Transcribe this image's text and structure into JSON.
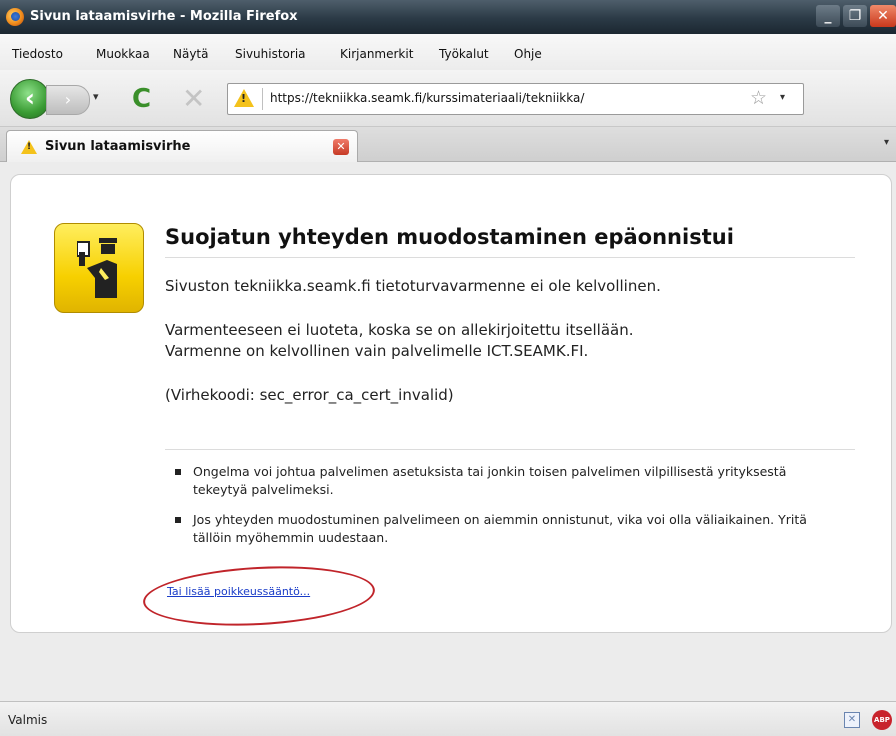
{
  "window": {
    "title": "Sivun lataamisvirhe - Mozilla Firefox",
    "controls": {
      "minimize": "_",
      "maximize": "❐",
      "close": "✕"
    }
  },
  "menu": [
    {
      "label": "Tiedosto"
    },
    {
      "label": "Muokkaa"
    },
    {
      "label": "Näytä"
    },
    {
      "label": "Sivuhistoria"
    },
    {
      "label": "Kirjanmerkit"
    },
    {
      "label": "Työkalut"
    },
    {
      "label": "Ohje"
    }
  ],
  "navbar": {
    "url": "https://tekniikka.seamk.fi/kurssimateriaali/tekniikka/",
    "icons": [
      "back-icon",
      "forward-icon",
      "history-dropdown-icon",
      "reload-icon",
      "stop-icon",
      "warning-icon",
      "bookmark-star-icon",
      "url-dropdown-icon"
    ]
  },
  "tab": {
    "title": "Sivun lataamisvirhe"
  },
  "error": {
    "title": "Suojatun yhteyden muodostaminen epäonnistui",
    "line1": "Sivuston tekniikka.seamk.fi tietoturvavarmenne ei ole kelvollinen.",
    "line2a": "Varmenteeseen ei luoteta, koska se on allekirjoitettu itsellään.",
    "line2b": "Varmenne on kelvollinen vain palvelimelle ICT.SEAMK.FI.",
    "code": "(Virhekoodi: sec_error_ca_cert_invalid)",
    "bullets": [
      "Ongelma voi johtua palvelimen asetuksista tai jonkin toisen palvelimen vilpillisestä yrityksestä tekeytyä palvelimeksi.",
      "Jos yhteyden muodostuminen palvelimeen on aiemmin onnistunut, vika voi olla väliaikainen. Yritä tällöin myöhemmin uudestaan."
    ],
    "exception_link": "Tai lisää poikkeussääntö..."
  },
  "status": {
    "text": "Valmis",
    "abp": "ABP"
  },
  "colors": {
    "titlebar": "#2b3a46",
    "link": "#1a3cc8",
    "annotation": "#c0242a",
    "warning": "#f4c21b"
  }
}
